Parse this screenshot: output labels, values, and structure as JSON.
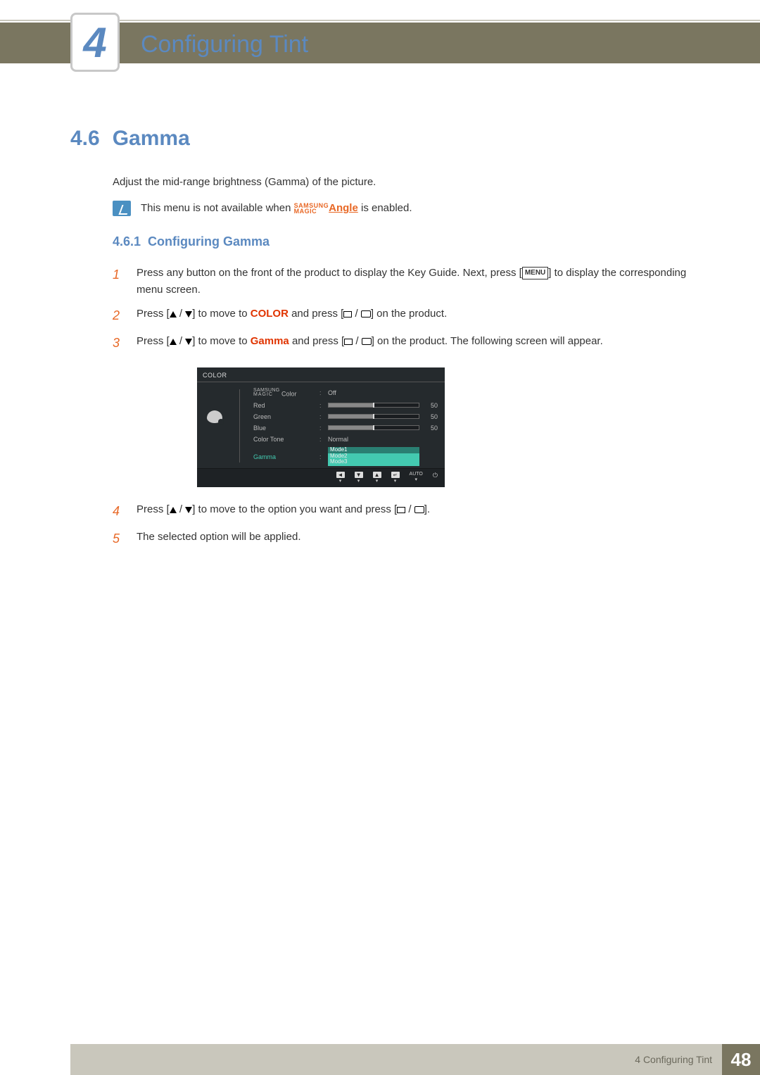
{
  "header": {
    "chapter_number": "4",
    "chapter_title": "Configuring Tint"
  },
  "section": {
    "number": "4.6",
    "title": "Gamma",
    "description": "Adjust the mid-range brightness (Gamma) of the picture.",
    "note_prefix": "This menu is not available when ",
    "note_magic_top": "SAMSUNG",
    "note_magic_bottom": "MAGIC",
    "note_angle": "Angle",
    "note_suffix": " is enabled."
  },
  "subsection": {
    "number": "4.6.1",
    "title": "Configuring Gamma"
  },
  "steps": {
    "s1a": "Press any button on the front of the product to display the Key Guide. Next, press [",
    "s1_menu": "MENU",
    "s1b": "] to display the corresponding menu screen.",
    "s2a": "Press [",
    "s2b": "] to move to ",
    "s2_color": "COLOR",
    "s2c": " and press [",
    "s2d": "] on the product.",
    "s3a": "Press [",
    "s3b": "] to move to ",
    "s3_gamma": "Gamma",
    "s3c": " and press [",
    "s3d": "] on the product. The following screen will appear.",
    "s4a": "Press [",
    "s4b": "] to move to the option you want and press [",
    "s4c": "].",
    "s5": "The selected option will be applied."
  },
  "osd": {
    "title": "COLOR",
    "magic_top": "SAMSUNG",
    "magic_bottom": "MAGIC",
    "magic_color_label": " Color",
    "magic_color_value": "Off",
    "red": "Red",
    "green": "Green",
    "blue": "Blue",
    "val50": "50",
    "color_tone": "Color Tone",
    "color_tone_value": "Normal",
    "gamma": "Gamma",
    "mode1": "Mode1",
    "mode2": "Mode2",
    "mode3": "Mode3",
    "auto": "AUTO"
  },
  "footer": {
    "text": "4 Configuring Tint",
    "page": "48"
  }
}
